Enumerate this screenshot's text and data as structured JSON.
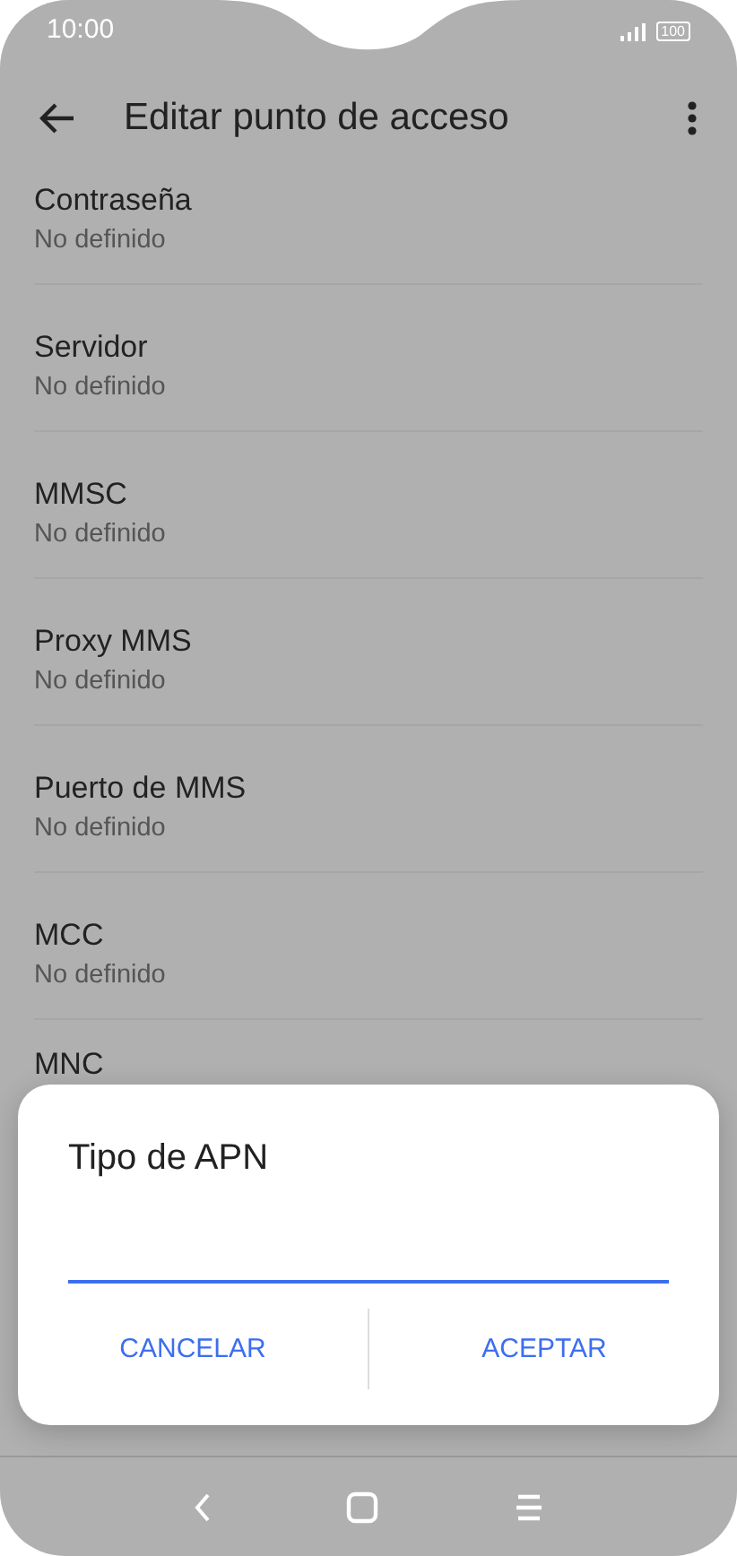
{
  "status_bar": {
    "time": "10:00",
    "battery": "100"
  },
  "app_bar": {
    "title": "Editar punto de acceso"
  },
  "settings": [
    {
      "title": "Contraseña",
      "value": "No definido"
    },
    {
      "title": "Servidor",
      "value": "No definido"
    },
    {
      "title": "MMSC",
      "value": "No definido"
    },
    {
      "title": "Proxy MMS",
      "value": "No definido"
    },
    {
      "title": "Puerto de MMS",
      "value": "No definido"
    },
    {
      "title": "MCC",
      "value": "No definido"
    },
    {
      "title": "MNC"
    }
  ],
  "dialog": {
    "title": "Tipo de APN",
    "buttons": [
      "CANCELAR",
      "ACEPTAR"
    ]
  }
}
